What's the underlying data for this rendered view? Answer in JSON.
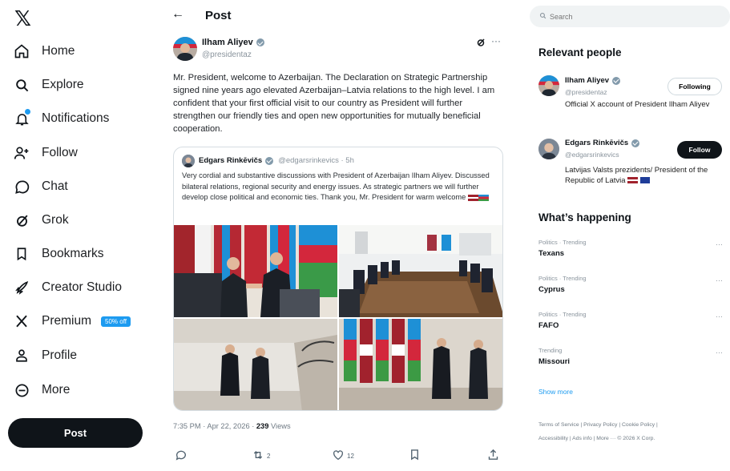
{
  "brand": {
    "logo": "𝕏"
  },
  "nav": [
    {
      "label": "Home"
    },
    {
      "label": "Explore"
    },
    {
      "label": "Notifications"
    },
    {
      "label": "Follow"
    },
    {
      "label": "Chat"
    },
    {
      "label": "Grok"
    },
    {
      "label": "Bookmarks"
    },
    {
      "label": "Creator Studio"
    },
    {
      "label": "Premium",
      "badge": "50% off"
    },
    {
      "label": "Profile"
    },
    {
      "label": "More"
    }
  ],
  "post_button": "Post",
  "header": {
    "title": "Post",
    "back": "←"
  },
  "post": {
    "author": "Ilham Aliyev",
    "handle": "@presidentaz",
    "text": "Mr. President, welcome to Azerbaijan. The Declaration on Strategic Partnership signed nine years ago elevated Azerbaijan–Latvia relations to the high level. I am confident that your first official visit to our country as President will further strengthen our friendly ties and open new opportunities for mutually beneficial cooperation.",
    "quote": {
      "author": "Edgars Rinkēvičs",
      "handle": "@edgarsrinkevics · 5h",
      "text": "Very cordial and substantive discussions with President of Azerbaijan Ilham Aliyev. Discussed bilateral relations, regional security and energy issues. As strategic partners we will further develop close political and economic ties. Thank you, Mr. President for warm welcome "
    },
    "meta": {
      "time": "7:35 PM · Apr 22, 2026 · ",
      "views_count": "239",
      "views_label": " Views"
    },
    "actions": {
      "retweets": "2",
      "likes": "12"
    }
  },
  "right": {
    "search_placeholder": "Search",
    "relevant_title": "Relevant people",
    "people": [
      {
        "name": "Ilham Aliyev",
        "handle": "@presidentaz",
        "bio": "Official X account of President Ilham Aliyev",
        "button": "Following"
      },
      {
        "name": "Edgars Rinkēvičs",
        "handle": "@edgarsrinkevics",
        "bio": "Latvijas Valsts prezidents/ President of the Republic of Latvia",
        "button": "Follow"
      }
    ],
    "happening_title": "What’s happening",
    "trends": [
      {
        "category": "Politics · Trending",
        "topic": "Texans"
      },
      {
        "category": "Politics · Trending",
        "topic": "Cyprus"
      },
      {
        "category": "Politics · Trending",
        "topic": "FAFO"
      },
      {
        "category": "Trending",
        "topic": "Missouri"
      }
    ],
    "show_more": "Show more",
    "footer": {
      "line1": "Terms of Service  |  Privacy Policy  |  Cookie Policy  |",
      "line2": "Accessibility  |  Ads info  |  More ···  © 2026 X Corp."
    }
  },
  "colors": {
    "accent": "#1d9bf0",
    "text": "#0f1419",
    "muted": "#536471"
  }
}
